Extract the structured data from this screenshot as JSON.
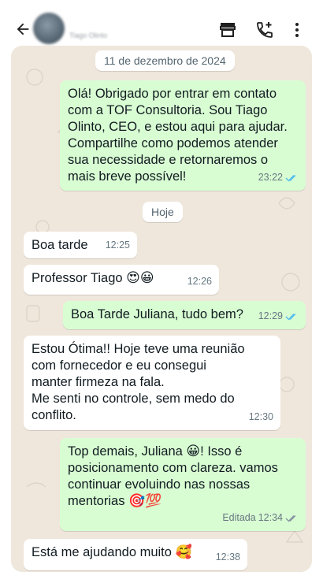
{
  "header": {
    "contact_name": "Tiago Olinto",
    "icons": [
      "back-arrow-icon",
      "store-icon",
      "add-call-icon",
      "more-vert-icon"
    ]
  },
  "chat": {
    "date_chip": "11 de dezembro de 2024",
    "today_chip": "Hoje",
    "messages": [
      {
        "dir": "out",
        "text": "Olá! Obrigado por entrar em contato\ncom a TOF Consultoria. Sou Tiago\nOlinto, CEO, e estou aqui para ajudar.\nCompartilhe como podemos atender\nsua necessidade e retornaremos o\nmais breve possível!",
        "time": "23:22",
        "status": "read"
      },
      {
        "dir": "in",
        "text": "Boa tarde",
        "time": "12:25"
      },
      {
        "dir": "in",
        "text": "Professor Tiago",
        "emoji": "😍😀",
        "time": "12:26"
      },
      {
        "dir": "out",
        "text": "Boa Tarde Juliana, tudo bem?",
        "time": "12:29",
        "status": "read"
      },
      {
        "dir": "in",
        "text": "Estou Ótima!! Hoje teve uma reunião\ncom fornecedor e eu consegui\nmanter firmeza na fala.\nMe senti no controle, sem medo do\nconflito.",
        "time": "12:30"
      },
      {
        "dir": "out",
        "text_a": "Top demais, Juliana ",
        "emoji_a": "😀",
        "text_b": "! Isso é\nposicionamento com clareza.  vamos\ncontinuar evoluindo nas nossas\nmentorias ",
        "emoji_b": "🎯💯",
        "edited": "Editada",
        "time": "12:34",
        "status": "delivered"
      },
      {
        "dir": "in",
        "text": "Está me ajudando muito ",
        "emoji": "🥰",
        "time": "12:38"
      }
    ]
  },
  "colors": {
    "incoming_bubble": "#ffffff",
    "outgoing_bubble": "#d9fdd3",
    "chat_background": "#efe7dc",
    "read_tick": "#53bdeb",
    "delivered_tick": "#8696a0",
    "meta_text": "#667781"
  }
}
